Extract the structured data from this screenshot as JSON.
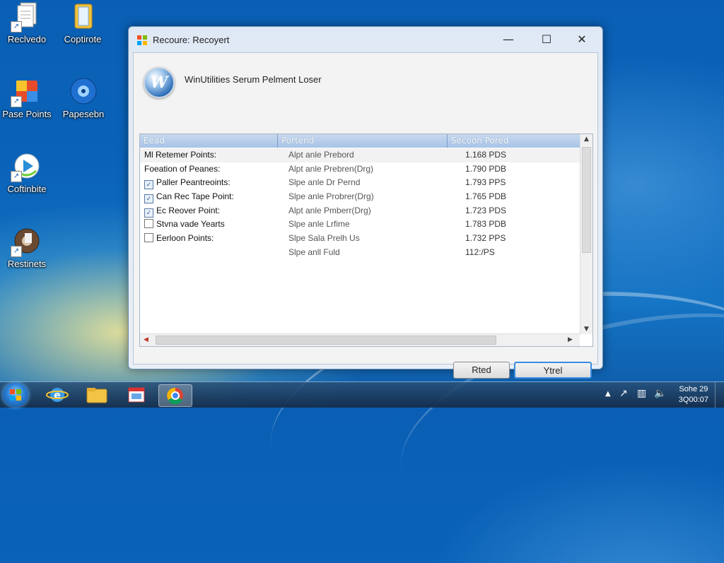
{
  "desktop": {
    "icons": [
      {
        "label": "Reclvedo",
        "icon": "document-icon"
      },
      {
        "label": "Coptirote",
        "icon": "folder-icon"
      },
      {
        "label": "Pase Points",
        "icon": "colorful-app-icon"
      },
      {
        "label": "Papesebn",
        "icon": "globe-disc-icon"
      },
      {
        "label": "Coftinbite",
        "icon": "media-player-icon"
      },
      {
        "label": "Restinets",
        "icon": "media-disc-icon"
      }
    ]
  },
  "window": {
    "title": "Recoure: Recoyert",
    "app_title": "WinUtilities Serum Pelment Loser",
    "logo_letter": "W",
    "controls": {
      "minimize": "—",
      "maximize": "☐",
      "close": "✕"
    },
    "list": {
      "columns": [
        "Eead",
        "Portend",
        "Secoon Pored"
      ],
      "rows": [
        {
          "name": "Ml Retemer Points:",
          "type": "Alpt anle Prebord",
          "size": "1.168 PDS",
          "icon": "none"
        },
        {
          "name": "Foeation of Peanes:",
          "type": "Alpt anle Prebren(Drg)",
          "size": "1.790 PDB",
          "icon": "none"
        },
        {
          "name": "Paller Peantreoints:",
          "type": "Slpe anle Dr Pernd",
          "size": "1.793 PPS",
          "icon": "checkbox"
        },
        {
          "name": "Can Rec Tape Point:",
          "type": "Slpe anle Probrer(Drg)",
          "size": "1.765 PDB",
          "icon": "checkbox"
        },
        {
          "name": "Ec Reover Point:",
          "type": "Alpt anle Pmberr(Drg)",
          "size": "1.723 PDS",
          "icon": "checkbox"
        },
        {
          "name": "Stvna vade Yearts",
          "type": "Slpe anle Lrfime",
          "size": "1.783 PDB",
          "icon": "box"
        },
        {
          "name": "Eerloon Points:",
          "type": "Slpe Sala Prelh Us",
          "size": "1.732 PPS",
          "icon": "box"
        },
        {
          "name": "",
          "type": "Slpe anll Fuld",
          "size": "112:/PS",
          "icon": "none"
        }
      ]
    },
    "buttons": {
      "secondary": "Rted",
      "primary": "Ytrel"
    }
  },
  "taskbar": {
    "pinned": [
      "internet-explorer-icon",
      "folder-icon",
      "app-window-icon",
      "chrome-icon"
    ],
    "active_index": 3,
    "tray": [
      "chevron-up-icon",
      "cursor-icon",
      "network-icon",
      "volume-icon"
    ],
    "clock": {
      "time": "Sohe 29",
      "date": "3Q00:07"
    }
  }
}
